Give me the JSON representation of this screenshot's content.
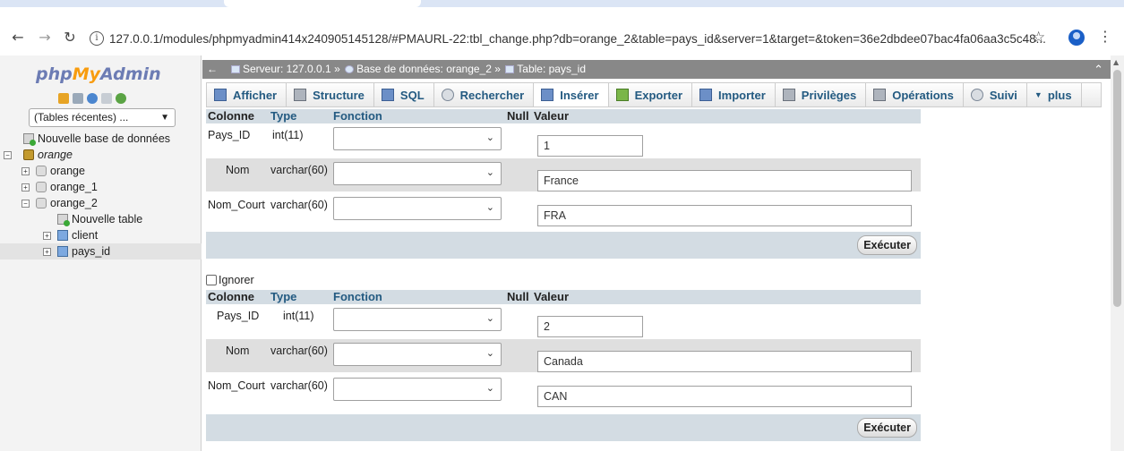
{
  "browser": {
    "url": "127.0.0.1/modules/phpmyadmin414x240905145128/#PMAURL-22:tbl_change.php?db=orange_2&table=pays_id&server=1&target=&token=36e2dbdee07bac4fa06aa3c5c48..."
  },
  "left": {
    "logo": {
      "php": "php",
      "my": "My",
      "admin": "Admin"
    },
    "recent_select": "(Tables récentes) ...",
    "tree": [
      {
        "label": "Nouvelle base de données",
        "level": 0,
        "icon": "new-db-icon"
      },
      {
        "label": "orange",
        "level": 0,
        "icon": "database-group-icon",
        "italic": true
      },
      {
        "label": "orange",
        "level": 1,
        "icon": "database-icon"
      },
      {
        "label": "orange_1",
        "level": 1,
        "icon": "database-icon"
      },
      {
        "label": "orange_2",
        "level": 1,
        "icon": "database-icon"
      },
      {
        "label": "Nouvelle table",
        "level": 2,
        "icon": "new-table-icon"
      },
      {
        "label": "client",
        "level": 2,
        "icon": "table-icon"
      },
      {
        "label": "pays_id",
        "level": 2,
        "icon": "table-icon",
        "selected": true
      }
    ]
  },
  "breadcrumb": {
    "server": "Serveur: 127.0.0.1",
    "sep1": "»",
    "database": "Base de données: orange_2",
    "sep2": "»",
    "table": "Table: pays_id"
  },
  "tabs": [
    {
      "label": "Afficher",
      "icon": "browse-icon"
    },
    {
      "label": "Structure",
      "icon": "structure-icon"
    },
    {
      "label": "SQL",
      "icon": "sql-icon"
    },
    {
      "label": "Rechercher",
      "icon": "search-icon"
    },
    {
      "label": "Insérer",
      "icon": "insert-icon",
      "active": true
    },
    {
      "label": "Exporter",
      "icon": "export-icon"
    },
    {
      "label": "Importer",
      "icon": "import-icon"
    },
    {
      "label": "Privilèges",
      "icon": "privileges-icon"
    },
    {
      "label": "Opérations",
      "icon": "operations-icon"
    },
    {
      "label": "Suivi",
      "icon": "tracking-icon"
    },
    {
      "label": "plus",
      "icon": "chevron-down-icon"
    }
  ],
  "headers": {
    "colonne": "Colonne",
    "type": "Type",
    "fonction": "Fonction",
    "null": "Null",
    "valeur": "Valeur"
  },
  "ignore_label": "Ignorer",
  "execute_label": "Exécuter",
  "records": [
    {
      "fields": [
        {
          "name": "Pays_ID",
          "type": "int(11)",
          "value": "1"
        },
        {
          "name": "Nom",
          "type": "varchar(60)",
          "value": "France"
        },
        {
          "name": "Nom_Court",
          "type": "varchar(60)",
          "value": "FRA"
        }
      ]
    },
    {
      "fields": [
        {
          "name": "Pays_ID",
          "type": "int(11)",
          "value": "2"
        },
        {
          "name": "Nom",
          "type": "varchar(60)",
          "value": "Canada"
        },
        {
          "name": "Nom_Court",
          "type": "varchar(60)",
          "value": "CAN"
        }
      ]
    }
  ]
}
